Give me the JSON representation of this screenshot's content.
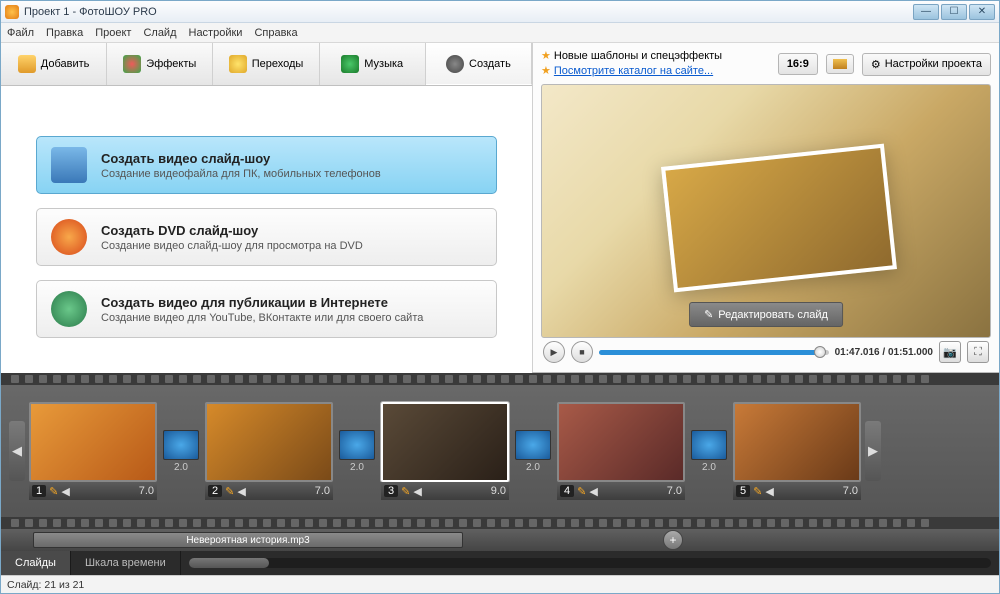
{
  "window": {
    "title": "Проект 1 - ФотоШОУ PRO"
  },
  "menu": [
    "Файл",
    "Правка",
    "Проект",
    "Слайд",
    "Настройки",
    "Справка"
  ],
  "tabs": {
    "add": "Добавить",
    "effects": "Эффекты",
    "transitions": "Переходы",
    "music": "Музыка",
    "create": "Создать"
  },
  "options": {
    "video": {
      "title": "Создать видео слайд-шоу",
      "desc": "Создание видеофайла для ПК, мобильных телефонов"
    },
    "dvd": {
      "title": "Создать DVD слайд-шоу",
      "desc": "Создание видео слайд-шоу для просмотра на DVD"
    },
    "web": {
      "title": "Создать видео для публикации в Интернете",
      "desc": "Создание видео для YouTube, ВКонтакте или для своего сайта"
    }
  },
  "tips": {
    "line1": "Новые шаблоны и спецэффекты",
    "line2": "Посмотрите каталог на сайте..."
  },
  "toolbar": {
    "aspect": "16:9",
    "settings": "Настройки проекта"
  },
  "preview": {
    "edit_btn": "Редактировать слайд",
    "time": "01:47.016 / 01:51.000"
  },
  "slides": [
    {
      "num": "1",
      "dur": "7.0",
      "tdur": "2.0",
      "bg": "linear-gradient(135deg,#e89a3a,#b85a18)"
    },
    {
      "num": "2",
      "dur": "7.0",
      "tdur": "2.0",
      "bg": "linear-gradient(135deg,#d68a2a,#7a4a18)"
    },
    {
      "num": "3",
      "dur": "9.0",
      "tdur": "2.0",
      "bg": "linear-gradient(135deg,#5a4a38,#2a2018)"
    },
    {
      "num": "4",
      "dur": "7.0",
      "tdur": "2.0",
      "bg": "linear-gradient(135deg,#a85a48,#5a2a28)"
    },
    {
      "num": "5",
      "dur": "7.0",
      "tdur": "",
      "bg": "linear-gradient(135deg,#c87a38,#6a3a18)"
    }
  ],
  "audio": {
    "track": "Невероятная история.mp3"
  },
  "view": {
    "slides": "Слайды",
    "timeline": "Шкала времени"
  },
  "status": "Слайд: 21 из 21"
}
